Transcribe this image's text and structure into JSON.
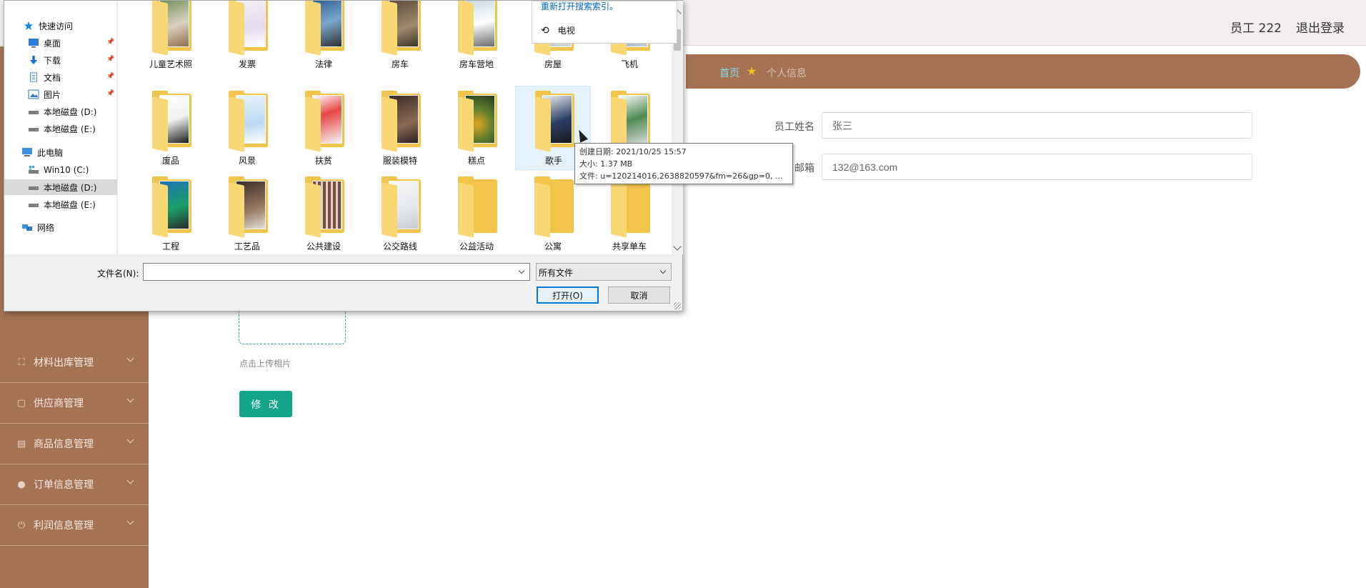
{
  "header": {
    "user": "员工 222",
    "logout": "退出登录"
  },
  "breadcrumb": {
    "home": "首页",
    "current": "个人信息"
  },
  "sidebar": {
    "items": [
      {
        "label": "材料出库管理",
        "icon": "scan-icon"
      },
      {
        "label": "供应商管理",
        "icon": "square-icon"
      },
      {
        "label": "商品信息管理",
        "icon": "clipboard-icon"
      },
      {
        "label": "订单信息管理",
        "icon": "user-icon"
      },
      {
        "label": "利润信息管理",
        "icon": "power-icon"
      }
    ]
  },
  "form": {
    "name_label": "员工姓名",
    "name_value": "张三",
    "email_label": "邮箱",
    "email_value": "132@163.com",
    "upload_hint": "点击上传相片",
    "submit": "修 改"
  },
  "dialog": {
    "nav": {
      "quick_access": "快速访问",
      "desktop": "桌面",
      "downloads": "下载",
      "documents": "文档",
      "pictures": "图片",
      "disk_d1": "本地磁盘 (D:)",
      "disk_e1": "本地磁盘 (E:)",
      "this_pc": "此电脑",
      "win10": "Win10 (C:)",
      "disk_d2": "本地磁盘 (D:)",
      "disk_e2": "本地磁盘 (E:)",
      "network": "网络"
    },
    "folders": [
      [
        "儿童艺术照",
        "发票",
        "法律",
        "房车",
        "房车营地",
        "房屋",
        "飞机"
      ],
      [
        "废品",
        "风景",
        "扶贫",
        "服装模特",
        "糕点",
        "歌手",
        ""
      ],
      [
        "工程",
        "工艺品",
        "公共建设",
        "公交路线",
        "公益活动",
        "公寓",
        "共享单车"
      ]
    ],
    "search_link": "重新打开搜索索引。",
    "history_item": "电视",
    "tooltip": {
      "created": "创建日期: 2021/10/25 15:57",
      "size": "大小: 1.37 MB",
      "files": "文件: u=120214016,2638820597&fm=26&gp=0, ..."
    },
    "filename_label": "文件名(N):",
    "filename_value": "",
    "filetype": "所有文件",
    "open": "打开(O)",
    "cancel": "取消"
  },
  "colors": {
    "sidebar": "#a67254",
    "accent": "#14a58a",
    "folder": "#f2c54a",
    "link": "#7fdcea"
  }
}
